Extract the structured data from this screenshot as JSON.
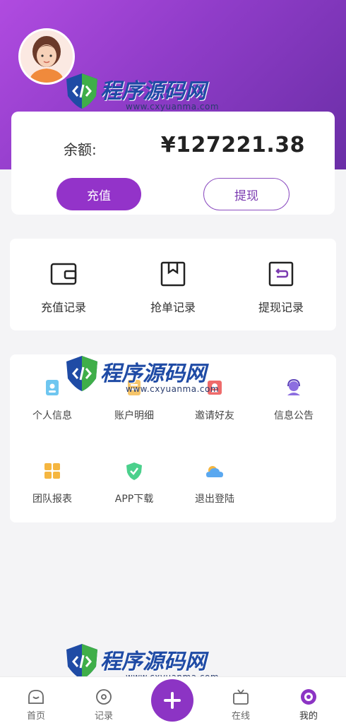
{
  "balance": {
    "label": "余额:",
    "value": "¥127221.38"
  },
  "actions": {
    "recharge_label": "充值",
    "withdraw_label": "提现"
  },
  "records": [
    {
      "label": "充值记录",
      "icon": "wallet-icon"
    },
    {
      "label": "抢单记录",
      "icon": "box-icon"
    },
    {
      "label": "提现记录",
      "icon": "return-icon"
    }
  ],
  "menu": [
    {
      "label": "个人信息",
      "icon": "id-card-icon"
    },
    {
      "label": "账户明细",
      "icon": "ledger-icon"
    },
    {
      "label": "邀请好友",
      "icon": "invite-icon"
    },
    {
      "label": "信息公告",
      "icon": "headset-icon"
    },
    {
      "label": "团队报表",
      "icon": "grid-icon"
    },
    {
      "label": "APP下载",
      "icon": "shield-icon"
    },
    {
      "label": "退出登陆",
      "icon": "cloud-icon"
    }
  ],
  "watermark": {
    "text": "程序源码网",
    "url": "www.cxyuanma.com"
  },
  "tabbar": {
    "home": "首页",
    "records": "记录",
    "online": "在线",
    "mine": "我的"
  },
  "colors": {
    "brand": "#9333c9",
    "hero_start": "#b04be0",
    "hero_end": "#6a2ea6"
  }
}
